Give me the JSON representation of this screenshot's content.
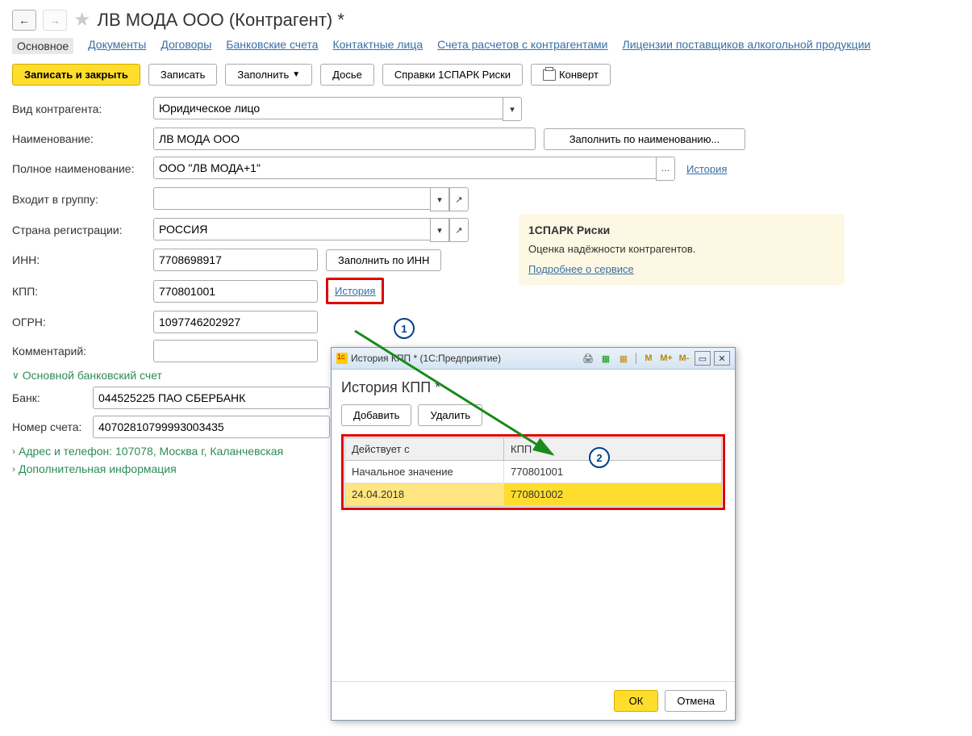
{
  "title": "ЛВ МОДА ООО (Контрагент) *",
  "tabs": {
    "t0": "Основное",
    "t1": "Документы",
    "t2": "Договоры",
    "t3": "Банковские счета",
    "t4": "Контактные лица",
    "t5": "Счета расчетов с контрагентами",
    "t6": "Лицензии поставщиков алкогольной продукции"
  },
  "toolbar": {
    "save_close": "Записать и закрыть",
    "save": "Записать",
    "fill": "Заполнить",
    "dossier": "Досье",
    "spark": "Справки 1СПАРК Риски",
    "envelope": "Конверт"
  },
  "fields": {
    "type_lbl": "Вид контрагента:",
    "type_val": "Юридическое лицо",
    "name_lbl": "Наименование:",
    "name_val": "ЛВ МОДА ООО",
    "fill_by_name": "Заполнить по наименованию...",
    "fullname_lbl": "Полное наименование:",
    "fullname_val": "ООО \"ЛВ МОДА+1\"",
    "history": "История",
    "group_lbl": "Входит в группу:",
    "group_val": "",
    "country_lbl": "Страна регистрации:",
    "country_val": "РОССИЯ",
    "inn_lbl": "ИНН:",
    "inn_val": "7708698917",
    "fill_by_inn": "Заполнить по ИНН",
    "kpp_lbl": "КПП:",
    "kpp_val": "770801001",
    "kpp_history": "История",
    "ogrn_lbl": "ОГРН:",
    "ogrn_val": "1097746202927",
    "comment_lbl": "Комментарий:",
    "comment_val": ""
  },
  "spark_box": {
    "title": "1СПАРК Риски",
    "text": "Оценка надёжности контрагентов.",
    "link": "Подробнее о сервисе"
  },
  "bank": {
    "section": "Основной банковский счет",
    "bank_lbl": "Банк:",
    "bank_val": "044525225 ПАО СБЕРБАНК",
    "acct_lbl": "Номер счета:",
    "acct_val": "40702810799993003435"
  },
  "sections": {
    "addr": "Адрес и телефон: 107078, Москва г, Каланчевская ",
    "extra": "Дополнительная информация"
  },
  "dialog": {
    "wtitle": "История КПП * (1С:Предприятие)",
    "heading": "История КПП *",
    "add": "Добавить",
    "del": "Удалить",
    "col1": "Действует с",
    "col2": "КПП",
    "r1c1": "Начальное значение",
    "r1c2": "770801001",
    "r2c1": "24.04.2018",
    "r2c2": "770801002",
    "ok": "ОК",
    "cancel": "Отмена",
    "m": "M",
    "mp": "M+",
    "mm": "M-"
  },
  "callouts": {
    "c1": "1",
    "c2": "2"
  }
}
